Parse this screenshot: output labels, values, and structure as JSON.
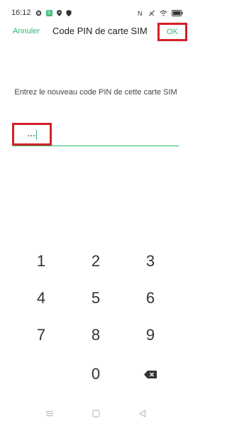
{
  "status_bar": {
    "time": "16:12",
    "icons_left": [
      "gear-icon",
      "notification-badge-icon",
      "location-icon",
      "shield-icon"
    ],
    "icons_right": [
      "nfc-icon",
      "no-signal-icon",
      "wifi-icon",
      "battery-icon"
    ]
  },
  "header": {
    "cancel_label": "Annuler",
    "title": "Code PIN de carte SIM",
    "ok_label": "OK"
  },
  "prompt_text": "Entrez le nouveau code PIN de cette carte SIM",
  "pin_field": {
    "value": "····"
  },
  "keypad": {
    "keys": [
      "1",
      "2",
      "3",
      "4",
      "5",
      "6",
      "7",
      "8",
      "9",
      "0"
    ],
    "backspace_icon": "backspace-icon"
  },
  "nav_bar": {
    "icons": [
      "menu-icon",
      "home-icon",
      "back-icon"
    ]
  },
  "colors": {
    "accent": "#2fb56f",
    "highlight": "#d4202a"
  }
}
